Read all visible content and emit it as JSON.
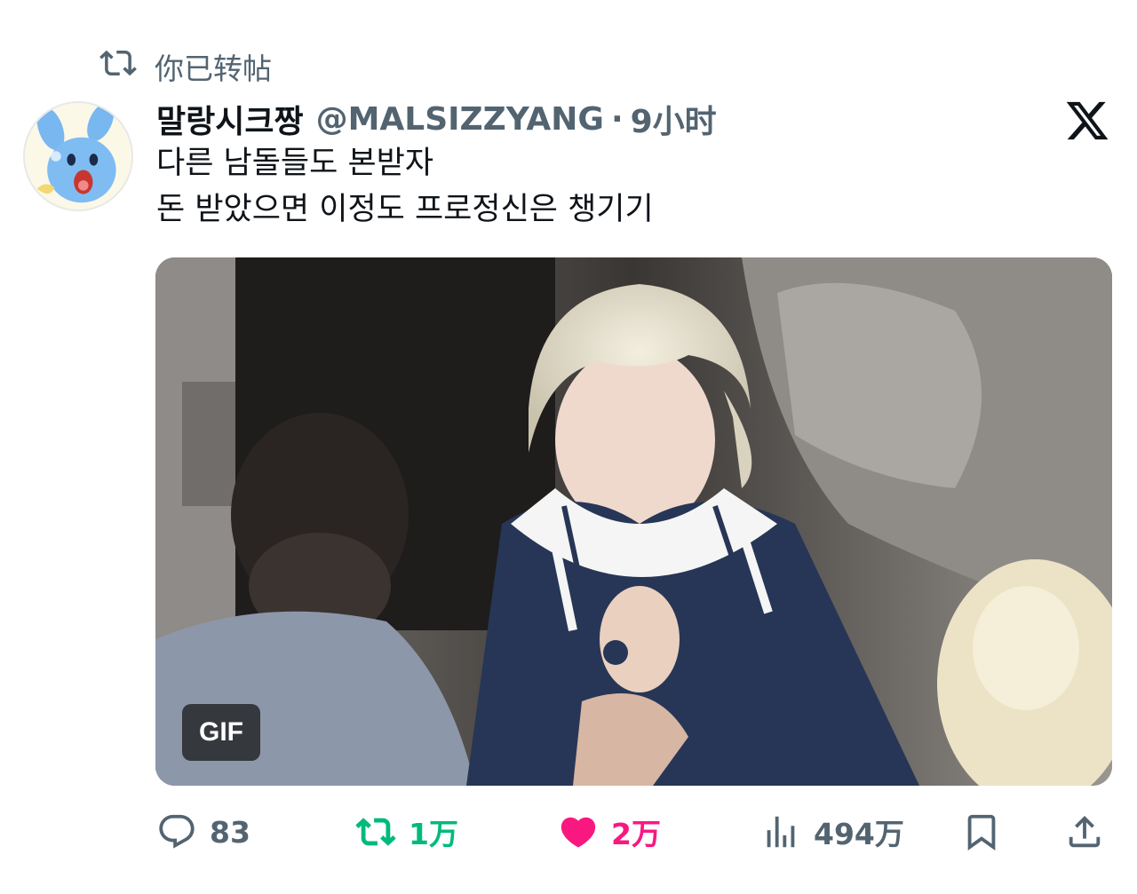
{
  "repost_banner": {
    "icon": "repost-icon",
    "text": "你已转帖"
  },
  "tweet": {
    "display_name": "말랑시크짱",
    "handle": "@MALSIZZYANG",
    "separator": "·",
    "time": "9小时",
    "text_lines": [
      "다른 남돌들도 본받자",
      "돈 받았으면 이정도 프로정신은 챙기기"
    ],
    "media": {
      "type": "gif",
      "badge": "GIF"
    }
  },
  "actions": {
    "reply_count": "83",
    "retweet_count": "1万",
    "like_count": "2万",
    "view_count": "494万"
  },
  "colors": {
    "text_primary": "#0f1419",
    "text_secondary": "#536471",
    "retweet_active": "#00ba7c",
    "like_active": "#f91880"
  }
}
